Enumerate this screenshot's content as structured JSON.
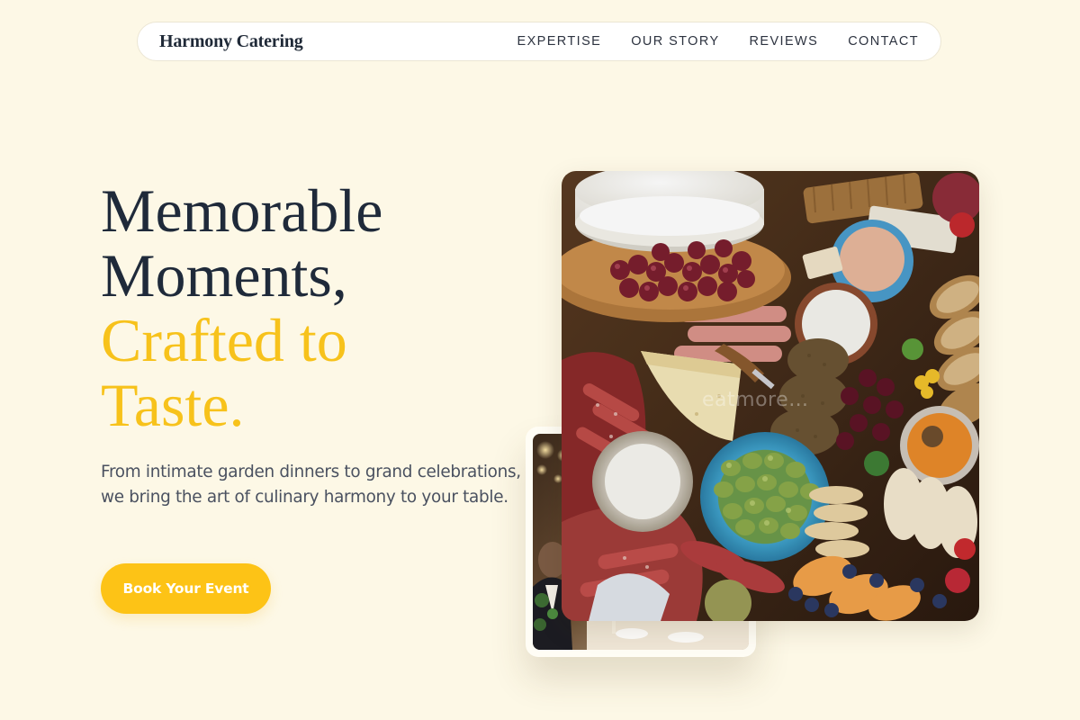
{
  "nav": {
    "brand": "Harmony Catering",
    "links": [
      {
        "label": "EXPERTISE"
      },
      {
        "label": "OUR STORY"
      },
      {
        "label": "REVIEWS"
      },
      {
        "label": "CONTACT"
      }
    ]
  },
  "hero": {
    "title_lines": [
      "Memorable",
      "Moments,"
    ],
    "accent_lines": [
      "Crafted to",
      "Taste."
    ],
    "subtitle": "From intimate garden dinners to grand celebrations, we bring the art of culinary harmony to your table.",
    "cta_label": "Book Your Event"
  },
  "images": {
    "main_watermark": "eatmore…"
  },
  "colors": {
    "background": "#fdf8e6",
    "accent": "#f7c21b",
    "button": "#fdc316",
    "heading": "#1f2a3a"
  },
  "icons": {
    "main_photo": "charcuterie-board-photo",
    "secondary_photo": "wedding-event-photo"
  }
}
